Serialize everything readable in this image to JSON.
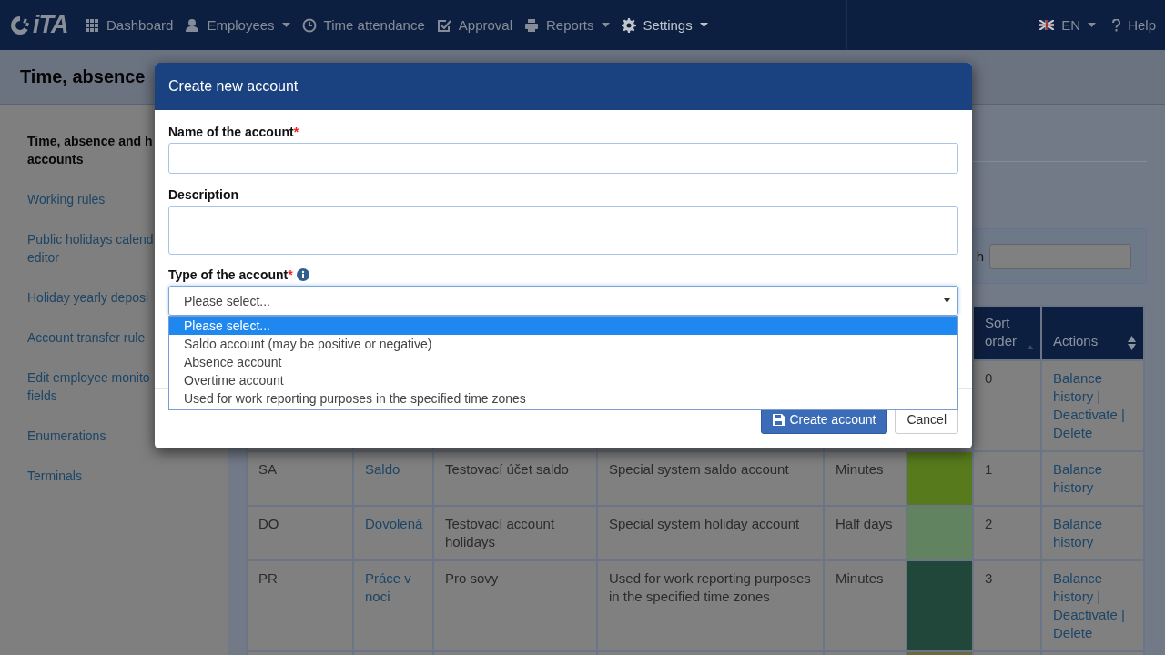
{
  "navbar": {
    "logo": "iTA",
    "items": [
      {
        "kind": "grid",
        "label": "Dashboard",
        "caret": false,
        "selected": false
      },
      {
        "kind": "user",
        "label": "Employees",
        "caret": true,
        "selected": false
      },
      {
        "kind": "clock",
        "label": "Time attendance",
        "caret": false,
        "selected": false
      },
      {
        "kind": "check",
        "label": "Approval",
        "caret": false,
        "selected": false
      },
      {
        "kind": "printer",
        "label": "Reports",
        "caret": true,
        "selected": false
      },
      {
        "kind": "gear",
        "label": "Settings",
        "caret": true,
        "selected": true
      }
    ],
    "language": "EN",
    "help": "Help"
  },
  "page_title": "Time, absence",
  "sidebar": {
    "items": [
      {
        "lines": [
          "Time, absence and h",
          "accounts"
        ],
        "selected": true
      },
      {
        "lines": [
          "Working rules"
        ],
        "selected": false
      },
      {
        "lines": [
          "Public holidays calend",
          "editor"
        ],
        "selected": false
      },
      {
        "lines": [
          "Holiday yearly deposi"
        ],
        "selected": false
      },
      {
        "lines": [
          "Account transfer rule"
        ],
        "selected": false
      },
      {
        "lines": [
          "Edit employee monito",
          "fields"
        ],
        "selected": false
      },
      {
        "lines": [
          "Enumerations"
        ],
        "selected": false
      },
      {
        "lines": [
          "Terminals"
        ],
        "selected": false
      }
    ]
  },
  "search": {
    "label": "h"
  },
  "table": {
    "columns": [
      "Sort order",
      "Actions"
    ],
    "rows": [
      {
        "sort_order": "0",
        "actions": "Balance history | Deactivate | Delete"
      },
      {
        "column_1": "SA",
        "column_2": "Saldo",
        "column_3": "Testovací účet saldo",
        "column_4": "Special system saldo account",
        "column_5": "Minutes",
        "color": "#567a1c",
        "sort_order": "1",
        "actions": "Balance history"
      },
      {
        "column_1": "DO",
        "column_2": "Dovolená",
        "column_3": "Testovací account holidays",
        "column_4": "Special system holiday account",
        "column_5": "Half days",
        "color": "#628360",
        "sort_order": "2",
        "actions": "Balance history"
      },
      {
        "column_1": "PR",
        "column_2": "Práce v noci",
        "column_3": "Pro sovy",
        "column_4": "Used for work reporting purposes in the specified time zones",
        "column_5": "Minutes",
        "color": "#21473a",
        "sort_order": "3",
        "actions": "Balance history | Deactivate | Delete"
      },
      {
        "color": "#6d6840"
      }
    ]
  },
  "modal": {
    "title": "Create new account",
    "name_field": {
      "label": "Name of the account",
      "required_mark": "*"
    },
    "description_field": {
      "label": "Description"
    },
    "type_field": {
      "label": "Type of the account",
      "required_mark": "*",
      "value": "Please select...",
      "options": [
        {
          "label": "Please select...",
          "selected": true
        },
        {
          "label": "Saldo account (may be positive or negative)",
          "selected": false
        },
        {
          "label": "Absence account",
          "selected": false
        },
        {
          "label": "Overtime account",
          "selected": false
        },
        {
          "label": "Used for work reporting purposes in the specified time zones",
          "selected": false
        }
      ]
    },
    "buttons": [
      {
        "kind": "primary",
        "label": "Create account"
      },
      {
        "kind": "default",
        "label": "Cancel"
      }
    ]
  }
}
